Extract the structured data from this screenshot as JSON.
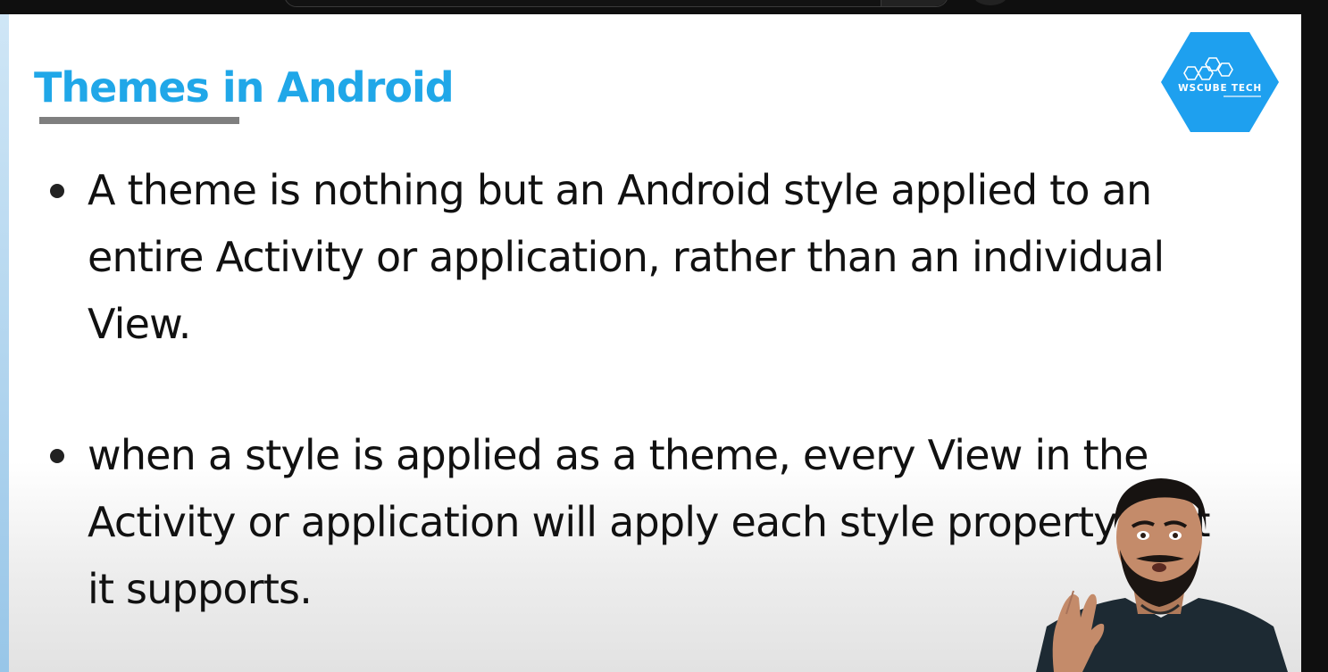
{
  "slide": {
    "title": "Themes in Android",
    "bullets": [
      "A theme is nothing but an Android style applied to an entire Activity or application, rather than an individual View.",
      "when a style is applied as a theme, every View in the Activity or application will apply each style property that it supports."
    ]
  },
  "logo": {
    "text": "WsCube Tech",
    "icon": "wscube-tech-logo-icon"
  },
  "presenter": {
    "icon": "presenter-video-icon"
  },
  "colors": {
    "title": "#20a7e8",
    "underline": "#7f7f7f",
    "logo_bg": "#1ea0ef",
    "background": "#ffffff",
    "chrome": "#0f0f0f"
  }
}
